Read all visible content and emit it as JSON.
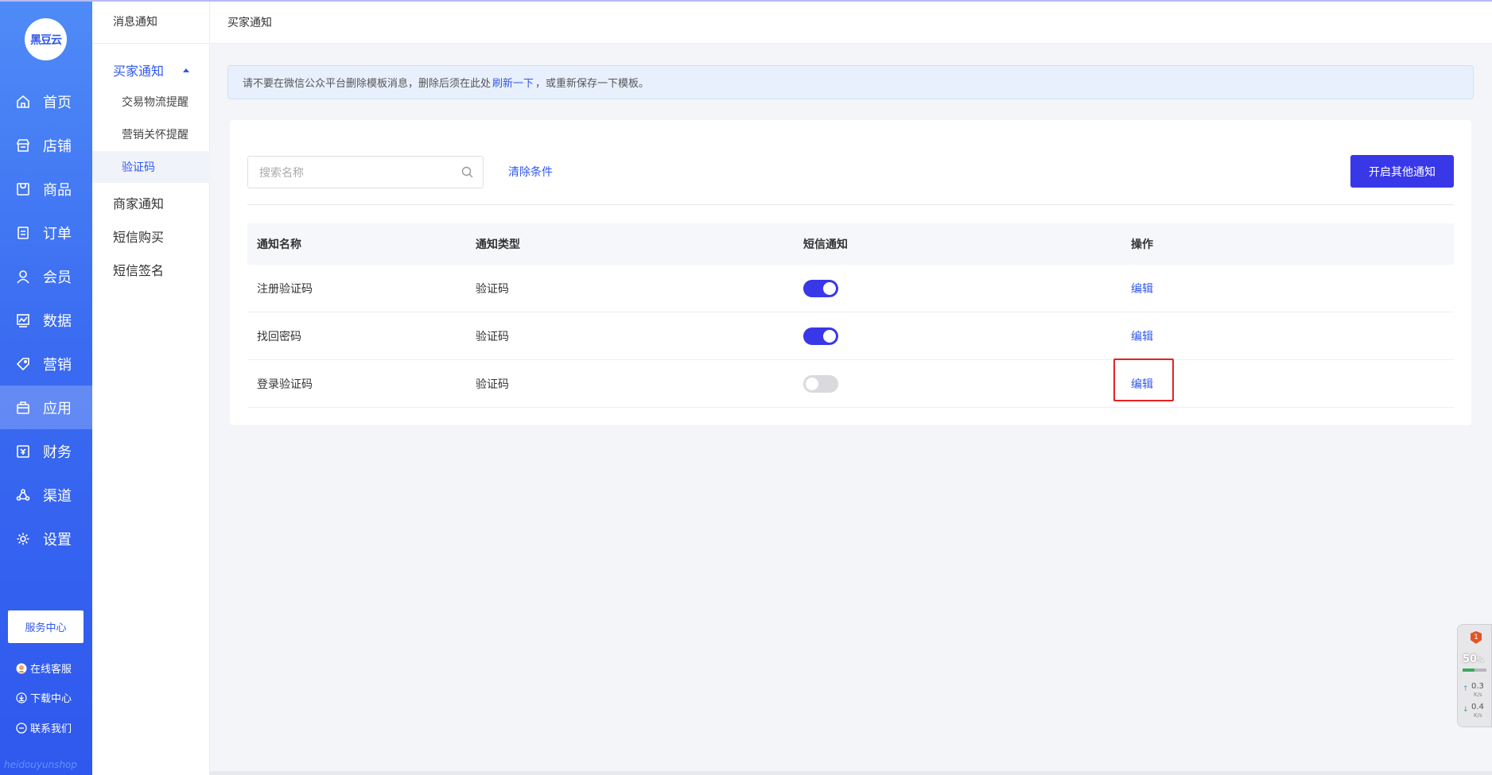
{
  "sidebar": {
    "logo_text": "黑豆云",
    "items": [
      {
        "label": "首页",
        "icon": "home-icon"
      },
      {
        "label": "店铺",
        "icon": "store-icon"
      },
      {
        "label": "商品",
        "icon": "goods-icon"
      },
      {
        "label": "订单",
        "icon": "order-icon"
      },
      {
        "label": "会员",
        "icon": "member-icon"
      },
      {
        "label": "数据",
        "icon": "data-icon"
      },
      {
        "label": "营销",
        "icon": "tag-icon"
      },
      {
        "label": "应用",
        "icon": "app-icon"
      },
      {
        "label": "财务",
        "icon": "finance-icon"
      },
      {
        "label": "渠道",
        "icon": "channel-icon"
      },
      {
        "label": "设置",
        "icon": "gear-icon"
      }
    ],
    "active_index": 7,
    "service_center": "服务中心",
    "online_service": "在线客服",
    "download_center": "下载中心",
    "contact_us": "联系我们",
    "watermark": "heidouyunshop"
  },
  "subnav": {
    "title": "消息通知",
    "groups": [
      {
        "label": "买家通知",
        "open": true,
        "items": [
          "交易物流提醒",
          "营销关怀提醒",
          "验证码"
        ],
        "active_item": 2
      },
      {
        "label": "商家通知"
      },
      {
        "label": "短信购买"
      },
      {
        "label": "短信签名"
      }
    ]
  },
  "header": {
    "title": "买家通知"
  },
  "notice": {
    "before": "请不要在微信公众平台删除模板消息，删除后须在此处",
    "link": "刷新一下",
    "after": "，或重新保存一下模板。"
  },
  "toolbar": {
    "search_placeholder": "搜索名称",
    "clear_label": "清除条件",
    "primary_label": "开启其他通知"
  },
  "table": {
    "columns": [
      "通知名称",
      "通知类型",
      "短信通知",
      "操作"
    ],
    "rows": [
      {
        "name": "注册验证码",
        "type": "验证码",
        "sms_on": true,
        "action": "编辑"
      },
      {
        "name": "找回密码",
        "type": "验证码",
        "sms_on": true,
        "action": "编辑"
      },
      {
        "name": "登录验证码",
        "type": "验证码",
        "sms_on": false,
        "action": "编辑",
        "highlighted": true
      }
    ]
  },
  "widget": {
    "badge": "1",
    "percent": "50",
    "percent_unit": "%",
    "usage_fraction": 0.5,
    "up_speed": "0.3",
    "down_speed": "0.4",
    "speed_unit": "K/s"
  },
  "colors": {
    "accent": "#2f58ee",
    "primary_button": "#3838e8",
    "highlight_border": "#e62222"
  }
}
